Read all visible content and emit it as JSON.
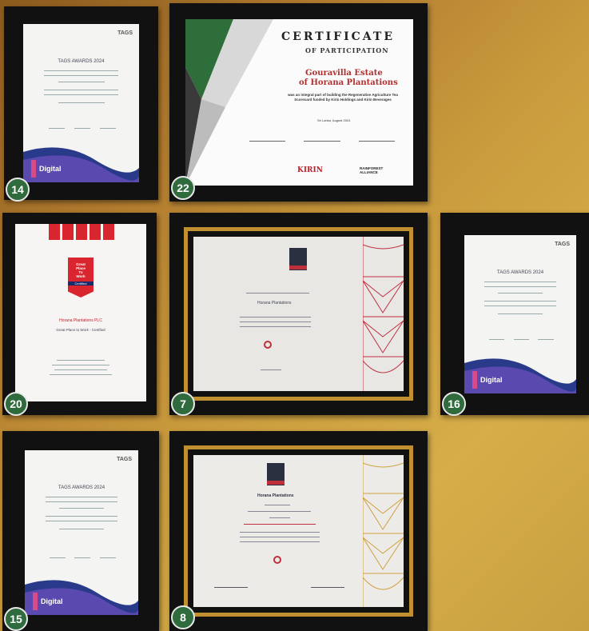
{
  "badges": {
    "b14": "14",
    "b22": "22",
    "b20": "20",
    "b7": "7",
    "b16": "16",
    "b15": "15",
    "b8": "8"
  },
  "tags": {
    "logo": "TAGS",
    "title": "TAGS AWARDS 2024"
  },
  "cert22": {
    "title": "CERTIFICATE",
    "subtitle": "OF PARTICIPATION",
    "estate": "Gouravilla Estate",
    "company": "of Horana Plantations",
    "body": "was an integral part of building the Regenerative Agriculture Tea Scorecard funded by Kirin Holdings and Kirin Beverages",
    "date": "Sri Lanka, August 2024",
    "logo1": "KIRIN",
    "logo2": "RAINFOREST ALLIANCE"
  },
  "gptw": {
    "line1": "Great",
    "line2": "Place",
    "line3": "To",
    "line4": "Work",
    "line5": "Certified",
    "company": "Horana Plantations PLC",
    "subtitle": "Great Place to Work - Certified"
  },
  "cert7": {
    "company": "Horana Plantations"
  },
  "cert8": {
    "company": "Horana Plantations"
  }
}
